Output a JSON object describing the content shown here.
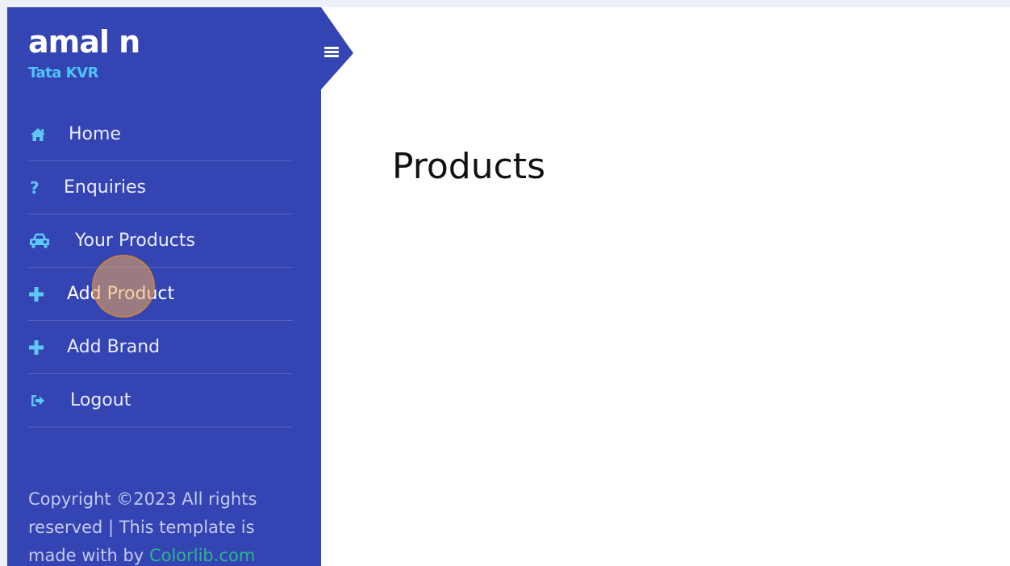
{
  "sidebar": {
    "user_name": "amal n",
    "user_org": "Tata KVR",
    "items": [
      {
        "label": "Home",
        "icon": "home-icon"
      },
      {
        "label": "Enquiries",
        "icon": "question-icon"
      },
      {
        "label": "Your Products",
        "icon": "car-icon"
      },
      {
        "label": "Add Product",
        "icon": "plus-icon"
      },
      {
        "label": "Add Brand",
        "icon": "plus-icon"
      },
      {
        "label": "Logout",
        "icon": "logout-icon"
      }
    ],
    "footer_text": "Copyright ©2023 All rights reserved | This template is made with by",
    "footer_link": "Colorlib.com"
  },
  "header": {
    "toggle_icon": "hamburger-icon"
  },
  "main": {
    "title": "Products"
  },
  "colors": {
    "sidebar_bg": "#3444b3",
    "accent": "#5bc8f5",
    "link": "#2ab68b",
    "page_bg": "#eef0f8",
    "content_bg": "#ffffff"
  }
}
